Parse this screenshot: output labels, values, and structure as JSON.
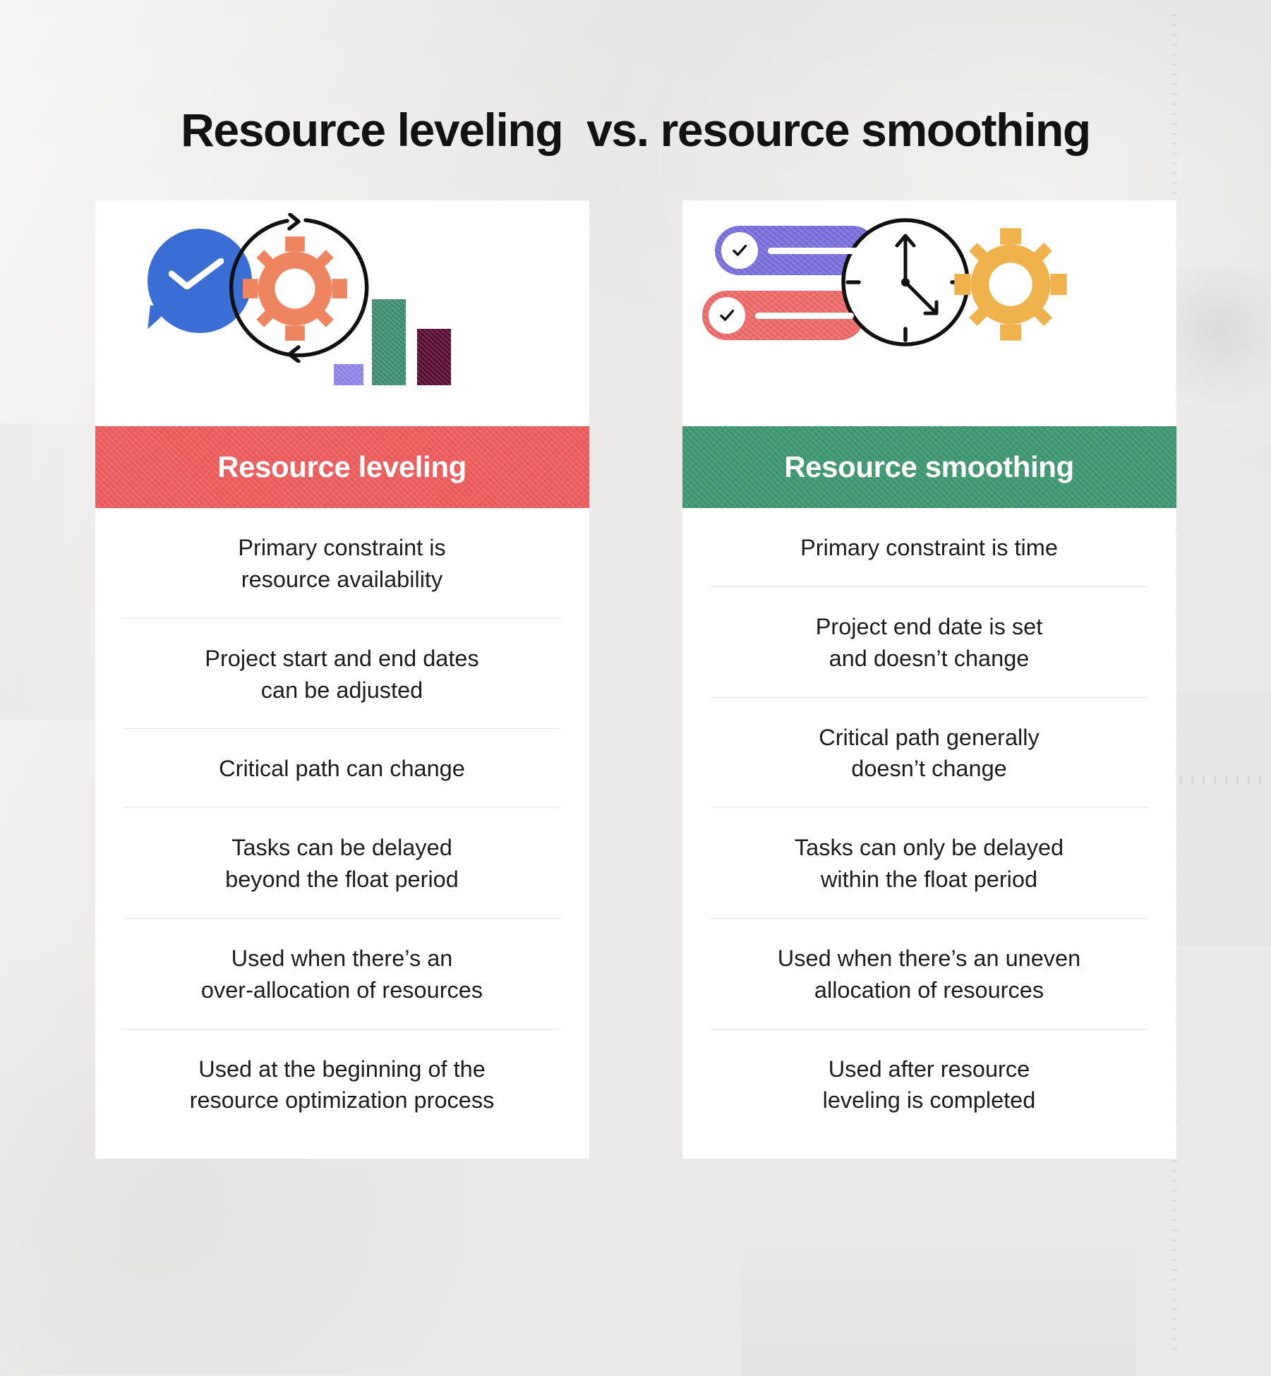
{
  "page": {
    "title": "Resource leveling  vs. resource smoothing",
    "background_color": "#eceaea"
  },
  "colors": {
    "leveling_band": "#ee5d5d",
    "smoothing_band": "#3f9872",
    "blue_bubble": "#3b6ed4",
    "orange_gear": "#ee8460",
    "purple_bar": "#8f86e8",
    "green_bar": "#3f8f72",
    "maroon_bar": "#5a0d35",
    "purple_pill": "#7a6fdc",
    "red_pill": "#ec6a68",
    "yellow_gear": "#efb24c",
    "text": "#1c1c1c",
    "divider": "#e4e4e4"
  },
  "columns": [
    {
      "id": "resource-leveling",
      "band_label": "Resource leveling",
      "band_color": "#ee5d5d",
      "illustration": {
        "icons": [
          "speech-bubble-check-icon",
          "cycle-arrows-icon",
          "gear-icon",
          "bar-chart-icon"
        ]
      },
      "rows": [
        "Primary constraint is\nresource availability",
        "Project start and end dates\ncan be adjusted",
        "Critical path can change",
        "Tasks can be delayed\nbeyond the float period",
        "Used when there’s an\nover-allocation of resources",
        "Used at the beginning of the\nresource optimization process"
      ]
    },
    {
      "id": "resource-smoothing",
      "band_label": "Resource smoothing",
      "band_color": "#3f9872",
      "illustration": {
        "icons": [
          "toggle-purple-check-icon",
          "toggle-red-check-icon",
          "clock-icon",
          "gear-icon"
        ]
      },
      "rows": [
        "Primary constraint is time",
        "Project end date is set\nand doesn’t change",
        "Critical path generally\ndoesn’t change",
        "Tasks can only be delayed\nwithin the float period",
        "Used when there’s an uneven\nallocation of resources",
        "Used after resource\nleveling is completed"
      ]
    }
  ]
}
